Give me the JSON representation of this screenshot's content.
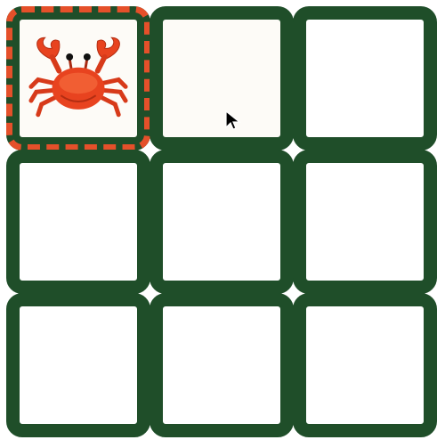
{
  "board": {
    "rows": 3,
    "cols": 3,
    "tiles": [
      {
        "row": 0,
        "col": 0,
        "content": "crab",
        "selected": true
      },
      {
        "row": 0,
        "col": 1,
        "content": "",
        "selected": false
      },
      {
        "row": 0,
        "col": 2,
        "content": "",
        "selected": false
      },
      {
        "row": 1,
        "col": 0,
        "content": "",
        "selected": false
      },
      {
        "row": 1,
        "col": 1,
        "content": "",
        "selected": false
      },
      {
        "row": 1,
        "col": 2,
        "content": "",
        "selected": false
      },
      {
        "row": 2,
        "col": 0,
        "content": "",
        "selected": false
      },
      {
        "row": 2,
        "col": 1,
        "content": "",
        "selected": false
      },
      {
        "row": 2,
        "col": 2,
        "content": "",
        "selected": false
      }
    ]
  },
  "colors": {
    "tile_border": "#1f4e29",
    "selection_dash": "#e5502a",
    "crab_body": "#e8431f",
    "tile_background": "#ffffff",
    "revealed_background": "#fdfbf7"
  },
  "icons": {
    "revealed_tile": "crab-icon",
    "pointer": "mouse-cursor-icon"
  }
}
